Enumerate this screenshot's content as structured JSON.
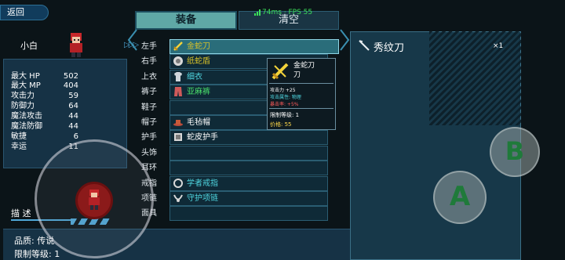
{
  "back_label": "返回",
  "character": {
    "name": "小白"
  },
  "stats": [
    {
      "label": "最大 HP",
      "value": "502"
    },
    {
      "label": "最大 MP",
      "value": "404"
    },
    {
      "label": "攻击力",
      "value": "59"
    },
    {
      "label": "防御力",
      "value": "64"
    },
    {
      "label": "魔法攻击",
      "value": "44"
    },
    {
      "label": "魔法防御",
      "value": "44"
    },
    {
      "label": "敏捷",
      "value": "6"
    },
    {
      "label": "幸运",
      "value": "11"
    }
  ],
  "tabs": {
    "equip": "装备",
    "clear": "清空"
  },
  "fps": "74ms · FPS 55",
  "slots": [
    {
      "label": "左手",
      "item": "金蛇刀",
      "color": "#d6c02a",
      "icon": "sword-icon"
    },
    {
      "label": "右手",
      "item": "纸蛇盾",
      "color": "#d6c02a",
      "icon": "shield-icon"
    },
    {
      "label": "上衣",
      "item": "细衣",
      "color": "#4fd6e0",
      "icon": "shirt-icon"
    },
    {
      "label": "裤子",
      "item": "亚麻裤",
      "color": "#4ade6a",
      "icon": "pants-icon"
    },
    {
      "label": "鞋子",
      "item": "",
      "color": "#ffffff",
      "icon": ""
    },
    {
      "label": "帽子",
      "item": "毛毡帽",
      "color": "#ffffff",
      "icon": "hat-icon"
    },
    {
      "label": "护手",
      "item": "蛇皮护手",
      "color": "#ffffff",
      "icon": "glove-icon"
    },
    {
      "label": "头饰",
      "item": "",
      "color": "#ffffff",
      "icon": ""
    },
    {
      "label": "耳环",
      "item": "",
      "color": "#ffffff",
      "icon": ""
    },
    {
      "label": "戒指",
      "item": "学者戒指",
      "color": "#4fd6e0",
      "icon": "ring-icon"
    },
    {
      "label": "项链",
      "item": "守护项链",
      "color": "#4fd6e0",
      "icon": "necklace-icon"
    },
    {
      "label": "面具",
      "item": "",
      "color": "#ffffff",
      "icon": ""
    }
  ],
  "tooltip": {
    "name_line1": "金蛇刀",
    "name_line2": "刀",
    "lines": [
      {
        "text": "攻击力 +25",
        "color": "#ffffff"
      },
      {
        "text": "攻击属性: 物理",
        "color": "#4fd6e0"
      },
      {
        "text": "暴击率: +5%",
        "color": "#ff5b5b"
      }
    ],
    "level": "限制等级: 1",
    "price": "价格: 55"
  },
  "detail": {
    "name": "秀纹刀",
    "count": "×1"
  },
  "description_tab": "描 述",
  "quality": "品质: 传说",
  "limit_level": "限制等级: 1",
  "buttons": {
    "a": "A",
    "b": "B"
  }
}
